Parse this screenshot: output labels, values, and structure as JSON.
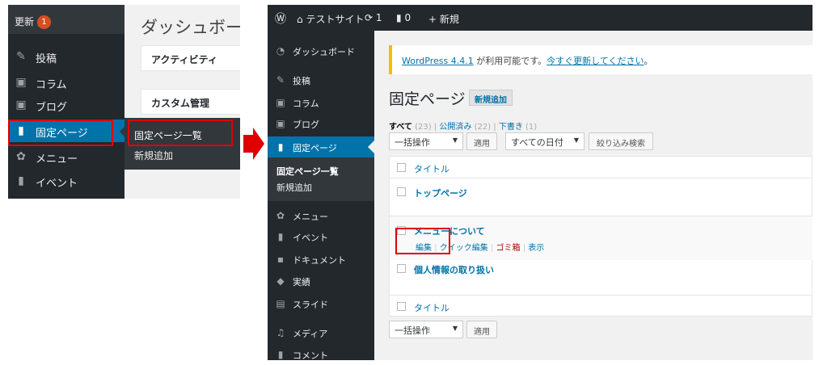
{
  "left_panel": {
    "update_label": "更新",
    "update_count": "1",
    "menu": [
      {
        "icon": "pushpin-icon",
        "label": "投稿"
      },
      {
        "icon": "column-icon",
        "label": "コラム"
      },
      {
        "icon": "blog-icon",
        "label": "ブログ"
      },
      {
        "icon": "pages-icon",
        "label": "固定ページ"
      },
      {
        "icon": "menu-brush-icon",
        "label": "メニュー"
      },
      {
        "icon": "event-icon",
        "label": "イベント"
      }
    ],
    "flyout": {
      "all_pages": "固定ページ一覧",
      "add_new": "新規追加"
    },
    "dashboard_title": "ダッシュボード",
    "boxes": {
      "activity": "アクティビティ",
      "custom": "カスタム管理"
    }
  },
  "right_panel": {
    "admin_bar": {
      "site_name": "テストサイト",
      "updates_count": "1",
      "comments_count": "0",
      "new_label": "新規"
    },
    "sidebar": {
      "dashboard": "ダッシュボード",
      "posts": "投稿",
      "column": "コラム",
      "blog": "ブログ",
      "pages": "固定ページ",
      "sub_all_pages": "固定ページ一覧",
      "sub_add_new": "新規追加",
      "menu": "メニュー",
      "event": "イベント",
      "document": "ドキュメント",
      "results": "実績",
      "slide": "スライド",
      "media": "メディア",
      "comments": "コメント"
    },
    "notice": {
      "version_link": "WordPress 4.4.1",
      "text": " が利用可能です。",
      "update_link": "今すぐ更新してください",
      "end": "。"
    },
    "page_title": "固定ページ",
    "add_new_button": "新規追加",
    "filters": {
      "all": "すべて",
      "all_count": "(23)",
      "published": "公開済み",
      "published_count": "(22)",
      "draft": "下書き",
      "draft_count": "(1)",
      "sep": "|"
    },
    "bulk_action": "一括操作",
    "apply": "適用",
    "all_dates": "すべての日付",
    "filter_button": "絞り込み検索",
    "column_title": "タイトル",
    "rows": [
      {
        "title": "トップページ"
      },
      {
        "title": "メニューについて"
      },
      {
        "title": "個人情報の取り扱い"
      }
    ],
    "row_actions": {
      "edit": "編集",
      "quick_edit": "クイック編集",
      "trash": "ゴミ箱",
      "view": "表示",
      "sep": "|"
    }
  },
  "colors": {
    "highlight": "#e00000",
    "active_menu": "#0073aa",
    "sidebar": "#23282d",
    "notice_border": "#ffb900"
  }
}
